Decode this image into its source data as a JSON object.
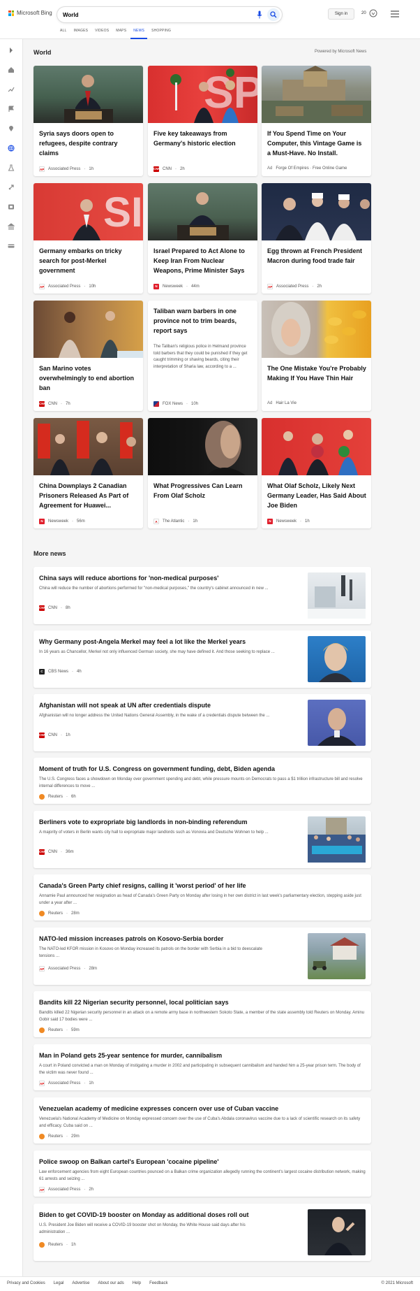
{
  "header": {
    "logo_text": "Microsoft Bing",
    "search_value": "World",
    "signin_label": "Sign in",
    "rewards_count": "20",
    "tabs": [
      {
        "label": "ALL"
      },
      {
        "label": "IMAGES"
      },
      {
        "label": "VIDEOS"
      },
      {
        "label": "MAPS"
      },
      {
        "label": "NEWS"
      },
      {
        "label": "SHOPPING"
      }
    ],
    "accent_color": "#174ae4"
  },
  "section": {
    "title": "World",
    "powered": "Powered by Microsoft News"
  },
  "cards": [
    {
      "title": "Syria says doors open to refugees, despite contrary claims",
      "source": "Associated Press",
      "time": "1h",
      "logo": "AP",
      "logo_color": "#d00"
    },
    {
      "title": "Five key takeaways from Germany's historic election",
      "source": "CNN",
      "time": "2h",
      "logo": "CNN",
      "logo_color": "#cc0000"
    },
    {
      "title": "If You Spend Time on Your Computer, this Vintage Game is a Must-Have. No Install.",
      "source": "Forge Of Empires · Free Online Game",
      "time": "",
      "logo": "Ad",
      "logo_color": "#888"
    },
    {
      "title": "Germany embarks on tricky search for post-Merkel government",
      "source": "Associated Press",
      "time": "10h",
      "logo": "AP",
      "logo_color": "#d00"
    },
    {
      "title": "Israel Prepared to Act Alone to Keep Iran From Nuclear Weapons, Prime Minister Says",
      "source": "Newsweek",
      "time": "44m",
      "logo": "N",
      "logo_color": "#e01e2b"
    },
    {
      "title": "Egg thrown at French President Macron during food trade fair",
      "source": "Associated Press",
      "time": "2h",
      "logo": "AP",
      "logo_color": "#d00"
    },
    {
      "title": "San Marino votes overwhelmingly to end abortion ban",
      "source": "CNN",
      "time": "7h",
      "logo": "CNN",
      "logo_color": "#cc0000"
    },
    {
      "title": "Taliban warn barbers in one province not to trim beards, report says",
      "desc": "The Taliban's religious police in Helmand province told barbers that they could be punished if they get caught trimming or shaving beards, citing their interpretation of Sharia law, according to a ...",
      "source": "FOX News",
      "time": "10h",
      "logo": "F",
      "logo_color": "#1e3c8c"
    },
    {
      "title": "The One Mistake You're Probably Making If You Have Thin Hair",
      "source": "Hair La Vie",
      "time": "",
      "logo": "Ad",
      "logo_color": "#888"
    },
    {
      "title": "China Downplays 2 Canadian Prisoners Released As Part of Agreement for Huawei...",
      "source": "Newsweek",
      "time": "56m",
      "logo": "N",
      "logo_color": "#e01e2b"
    },
    {
      "title": "What Progressives Can Learn From Olaf Scholz",
      "source": "The Atlantic",
      "time": "1h",
      "logo": "A",
      "logo_color": "#c00"
    },
    {
      "title": "What Olaf Scholz, Likely Next Germany Leader, Has Said About Joe Biden",
      "source": "Newsweek",
      "time": "1h",
      "logo": "N",
      "logo_color": "#e01e2b"
    }
  ],
  "more_news": {
    "title": "More news",
    "items": [
      {
        "title": "China says will reduce abortions for 'non-medical purposes'",
        "desc": "China will reduce the number of abortions performed for \"non-medical purposes,\" the country's cabinet announced in new ...",
        "source": "CNN",
        "time": "8h",
        "logo": "CNN",
        "logo_color": "#cc0000"
      },
      {
        "title": "Why Germany post-Angela Merkel may feel a lot like the Merkel years",
        "desc": "In 16 years as Chancellor, Merkel not only influenced German society, she may have defined it. And those seeking to replace ...",
        "source": "CBS News",
        "time": "4h",
        "logo": "C",
        "logo_color": "#222"
      },
      {
        "title": "Afghanistan will not speak at UN after credentials dispute",
        "desc": "Afghanistan will no longer address the United Nations General Assembly, in the wake of a credentials dispute between the ...",
        "source": "CNN",
        "time": "1h",
        "logo": "CNN",
        "logo_color": "#cc0000"
      },
      {
        "title": "Moment of truth for U.S. Congress on government funding, debt, Biden agenda",
        "desc": "The U.S. Congress faces a showdown on Monday over government spending and debt, while pressure mounts on Democrats to pass a $1 trillion infrastructure bill and resolve internal differences to move ...",
        "source": "Reuters",
        "time": "6h",
        "logo": "R",
        "logo_color": "#f08a24"
      },
      {
        "title": "Berliners vote to expropriate big landlords in non-binding referendum",
        "desc": "A majority of voters in Berlin wants city hall to expropriate major landlords such as Vonovia and Deutsche Wohnen to help ...",
        "source": "CNN",
        "time": "36m",
        "logo": "CNN",
        "logo_color": "#cc0000"
      },
      {
        "title": "Canada's Green Party chief resigns, calling it 'worst period' of her life",
        "desc": "Annamie Paul announced her resignation as head of Canada's Green Party on Monday after losing in her own district in last week's parliamentary election, stepping aside just under a year after ...",
        "source": "Reuters",
        "time": "28m",
        "logo": "R",
        "logo_color": "#f08a24"
      },
      {
        "title": "NATO-led mission increases patrols on Kosovo-Serbia border",
        "desc": "The NATO-led KFOR mission in Kosovo on Monday increased its patrols on the border with Serbia in a bid to deescalate tensions ...",
        "source": "Associated Press",
        "time": "28m",
        "logo": "AP",
        "logo_color": "#d00"
      },
      {
        "title": "Bandits kill 22 Nigerian security personnel, local politician says",
        "desc": "Bandits killed 22 Nigerian security personnel in an attack on a remote army base in northwestern Sokoto State, a member of the state assembly told Reuters on Monday. Aminu Gobir said 17 bodies were ...",
        "source": "Reuters",
        "time": "59m",
        "logo": "R",
        "logo_color": "#f08a24"
      },
      {
        "title": "Man in Poland gets 25-year sentence for murder, cannibalism",
        "desc": "A court in Poland convicted a man on Monday of instigating a murder in 2002 and participating in subsequent cannibalism and handed him a 25-year prison term. The body of the victim was never found ...",
        "source": "Associated Press",
        "time": "1h",
        "logo": "AP",
        "logo_color": "#d00"
      },
      {
        "title": "Venezuelan academy of medicine expresses concern over use of Cuban vaccine",
        "desc": "Venezuela's National Academy of Medicine on Monday expressed concern over the use of Cuba's Abdala coronavirus vaccine due to a lack of scientific research on its safety and efficacy. Cuba said on ...",
        "source": "Reuters",
        "time": "29m",
        "logo": "R",
        "logo_color": "#f08a24"
      },
      {
        "title": "Police swoop on Balkan cartel's European 'cocaine pipeline'",
        "desc": "Law enforcement agencies from eight European countries pounced on a Balkan crime organization allegedly running the continent's largest cocaine distribution network, making 61 arrests and seizing ...",
        "source": "Associated Press",
        "time": "2h",
        "logo": "AP",
        "logo_color": "#d00"
      },
      {
        "title": "Biden to get COVID-19 booster on Monday as additional doses roll out",
        "desc": "U.S. President Joe Biden will receive a COVID-19 booster shot on Monday, the White House said days after his administration ...",
        "source": "Reuters",
        "time": "1h",
        "logo": "R",
        "logo_color": "#f08a24"
      }
    ]
  },
  "footer": {
    "links": [
      "Privacy and Cookies",
      "Legal",
      "Advertise",
      "About our ads",
      "Help",
      "Feedback"
    ],
    "copyright": "© 2021 Microsoft"
  }
}
